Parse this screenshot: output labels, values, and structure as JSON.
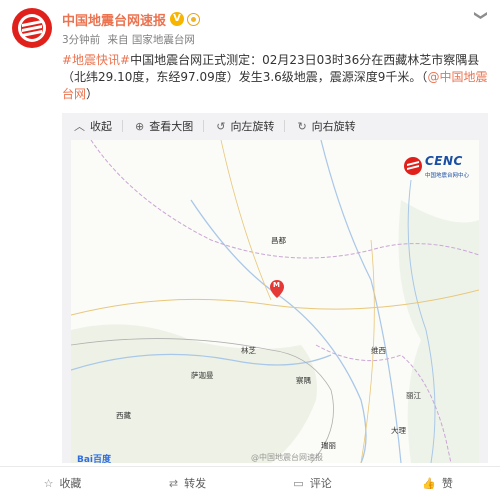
{
  "post": {
    "author": "中国地震台网速报",
    "verified_badge": "V",
    "time": "3分钟前",
    "source_prefix": "来自",
    "source": "国家地震台网",
    "hashtag": "#地震快讯#",
    "body": "中国地震台网正式测定：02月23日03时36分在西藏林芝市察隅县（北纬29.10度，东经97.09度）发生3.6级地震，震源深度9千米。（",
    "mention": "@中国地震台网",
    "close_paren": "）"
  },
  "toolbar": {
    "collapse": "收起",
    "view_large": "查看大图",
    "rotate_left": "向左旋转",
    "rotate_right": "向右旋转"
  },
  "map": {
    "logo_title": "CENC",
    "logo_subtitle": "中国地震台网中心",
    "baidu": "Bai百度",
    "watermark": "@中国地震台网速报",
    "epicenter_marker": "M",
    "cities": [
      "昌都",
      "林芝",
      "萨迦曼",
      "察隅",
      "维西",
      "丽江",
      "大理",
      "西藏",
      "瑞丽"
    ]
  },
  "actions": {
    "favorite": "收藏",
    "repost": "转发",
    "comment": "评论",
    "like": "赞"
  },
  "colors": {
    "accent": "#eb7350",
    "avatar": "#e0211b",
    "marker": "#e53935"
  },
  "icons": [
    "avatar-logo-icon",
    "verified-icon",
    "gold-badge-icon",
    "chevron-down-icon",
    "collapse-icon",
    "zoom-icon",
    "rotate-left-icon",
    "rotate-right-icon",
    "map-marker-icon",
    "star-icon",
    "repost-icon",
    "comment-icon",
    "like-icon"
  ]
}
